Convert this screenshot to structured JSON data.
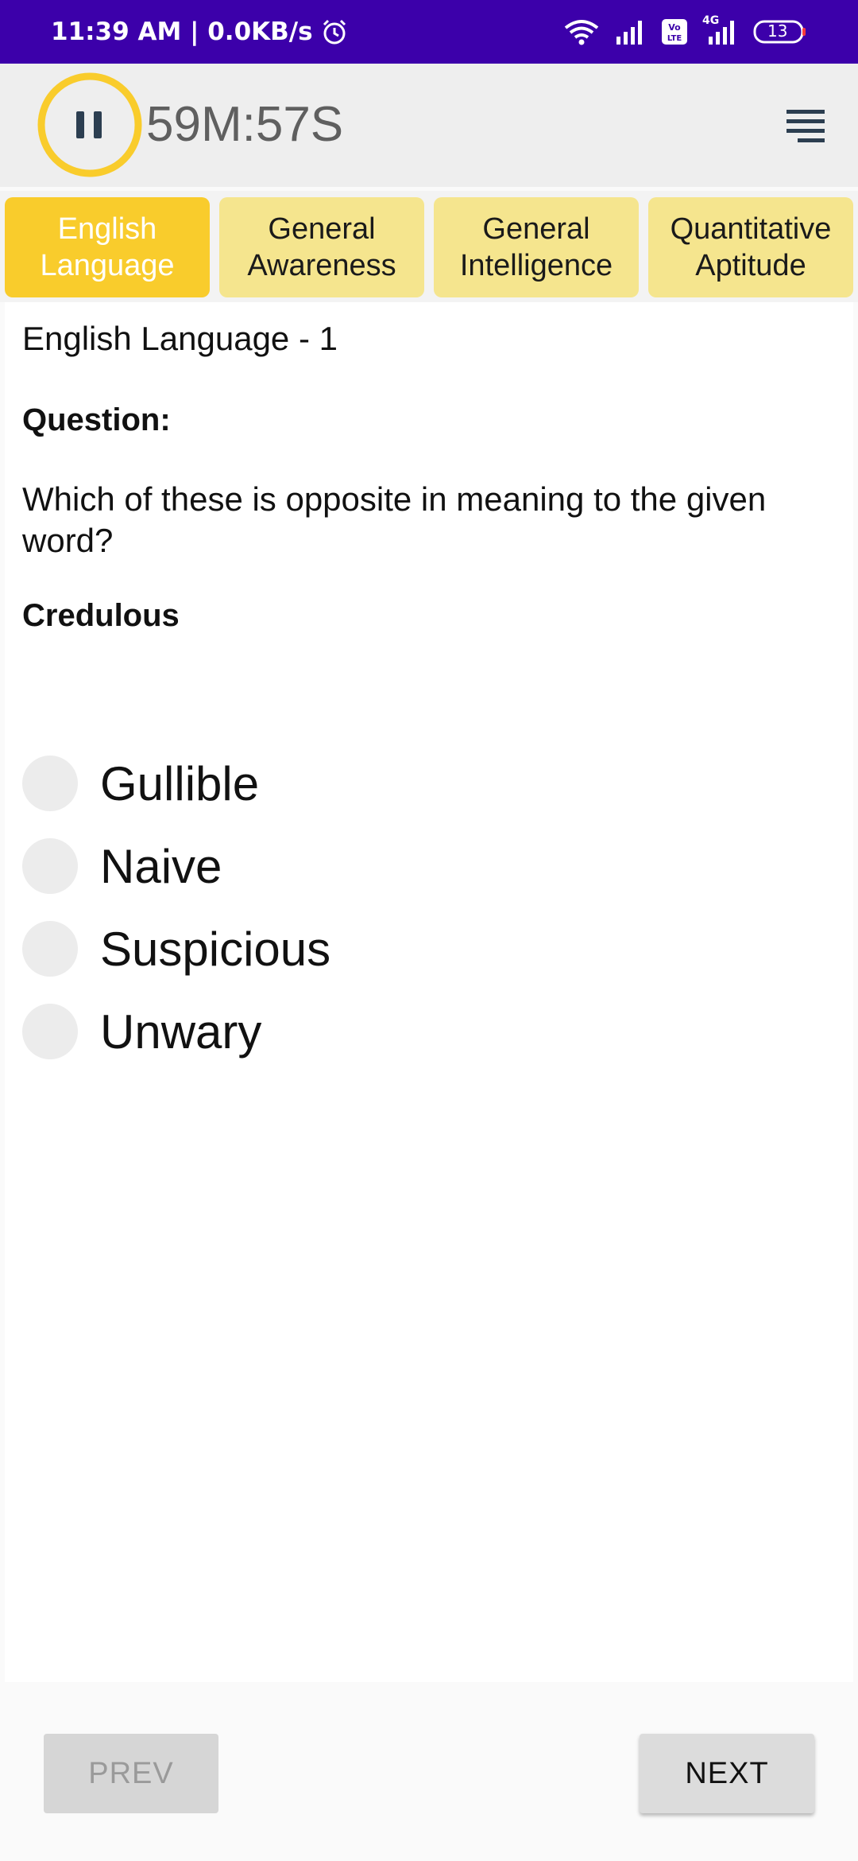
{
  "status_bar": {
    "time_speed": "11:39 AM | 0.0KB/s",
    "network_label": "4G",
    "volte_label": "Vo LTE",
    "battery_level": "13",
    "icons": [
      "alarm-icon",
      "wifi-icon",
      "signal-icon",
      "volte-icon",
      "battery-icon"
    ]
  },
  "header": {
    "timer": "59M:57S",
    "icons": [
      "pause-icon",
      "menu-icon"
    ]
  },
  "tabs": [
    {
      "label": "English Language",
      "active": true
    },
    {
      "label": "General Awareness",
      "active": false
    },
    {
      "label": "General Intelligence",
      "active": false
    },
    {
      "label": "Quantitative Aptitude",
      "active": false
    }
  ],
  "question": {
    "section_title": "English Language - 1",
    "label": "Question:",
    "text": "Which of these is opposite in meaning to the given word?",
    "word": "Credulous",
    "options": [
      "Gullible",
      "Naive",
      "Suspicious",
      "Unwary"
    ]
  },
  "navigation": {
    "prev_label": "PREV",
    "next_label": "NEXT"
  },
  "colors": {
    "status_bar": "#3c00aa",
    "accent_yellow": "#f9cc2c",
    "tab_inactive": "#f5e58e"
  }
}
